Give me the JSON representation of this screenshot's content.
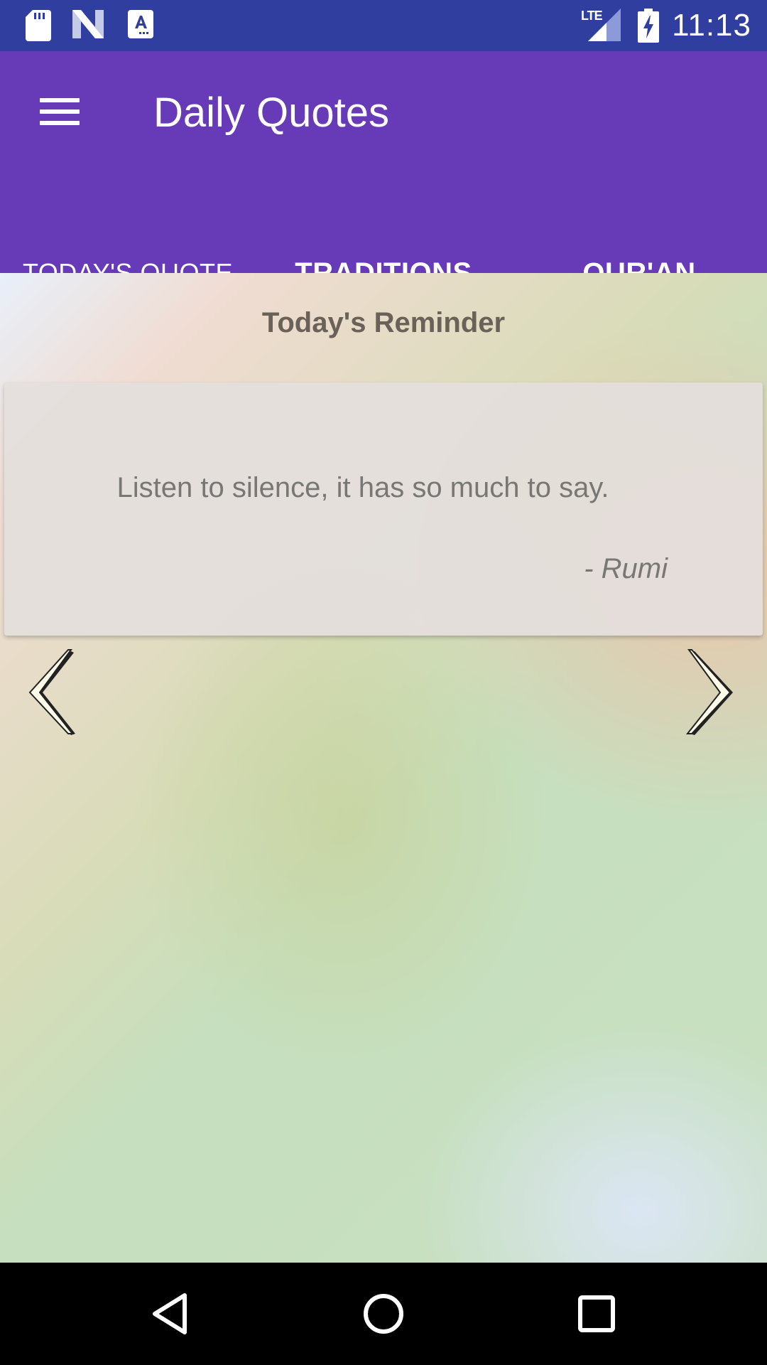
{
  "status_bar": {
    "time": "11:13",
    "network": "LTE",
    "icons": [
      "sd-card-icon",
      "n-logo-icon",
      "text-a-icon",
      "lte-signal-icon",
      "battery-charging-icon"
    ]
  },
  "app_bar": {
    "title": "Daily Quotes",
    "menu_icon": "hamburger-menu-icon"
  },
  "tabs": [
    {
      "label": "TODAY'S QUOTE",
      "selected": true
    },
    {
      "label": "TRADITIONS",
      "selected": false
    },
    {
      "label": "QUR'AN",
      "selected": false
    }
  ],
  "content": {
    "heading": "Today's Reminder",
    "quote": "Listen to silence, it has so much to say.",
    "author": "- Rumi",
    "prev_icon": "chevron-left-icon",
    "next_icon": "chevron-right-icon"
  },
  "nav_bar": {
    "icons": [
      "back-triangle-icon",
      "home-circle-icon",
      "recents-square-icon"
    ]
  },
  "colors": {
    "status_bar": "#303f9f",
    "app_bar": "#673ab7",
    "tab_indicator": "#ff4081",
    "nav_bar": "#000000"
  }
}
